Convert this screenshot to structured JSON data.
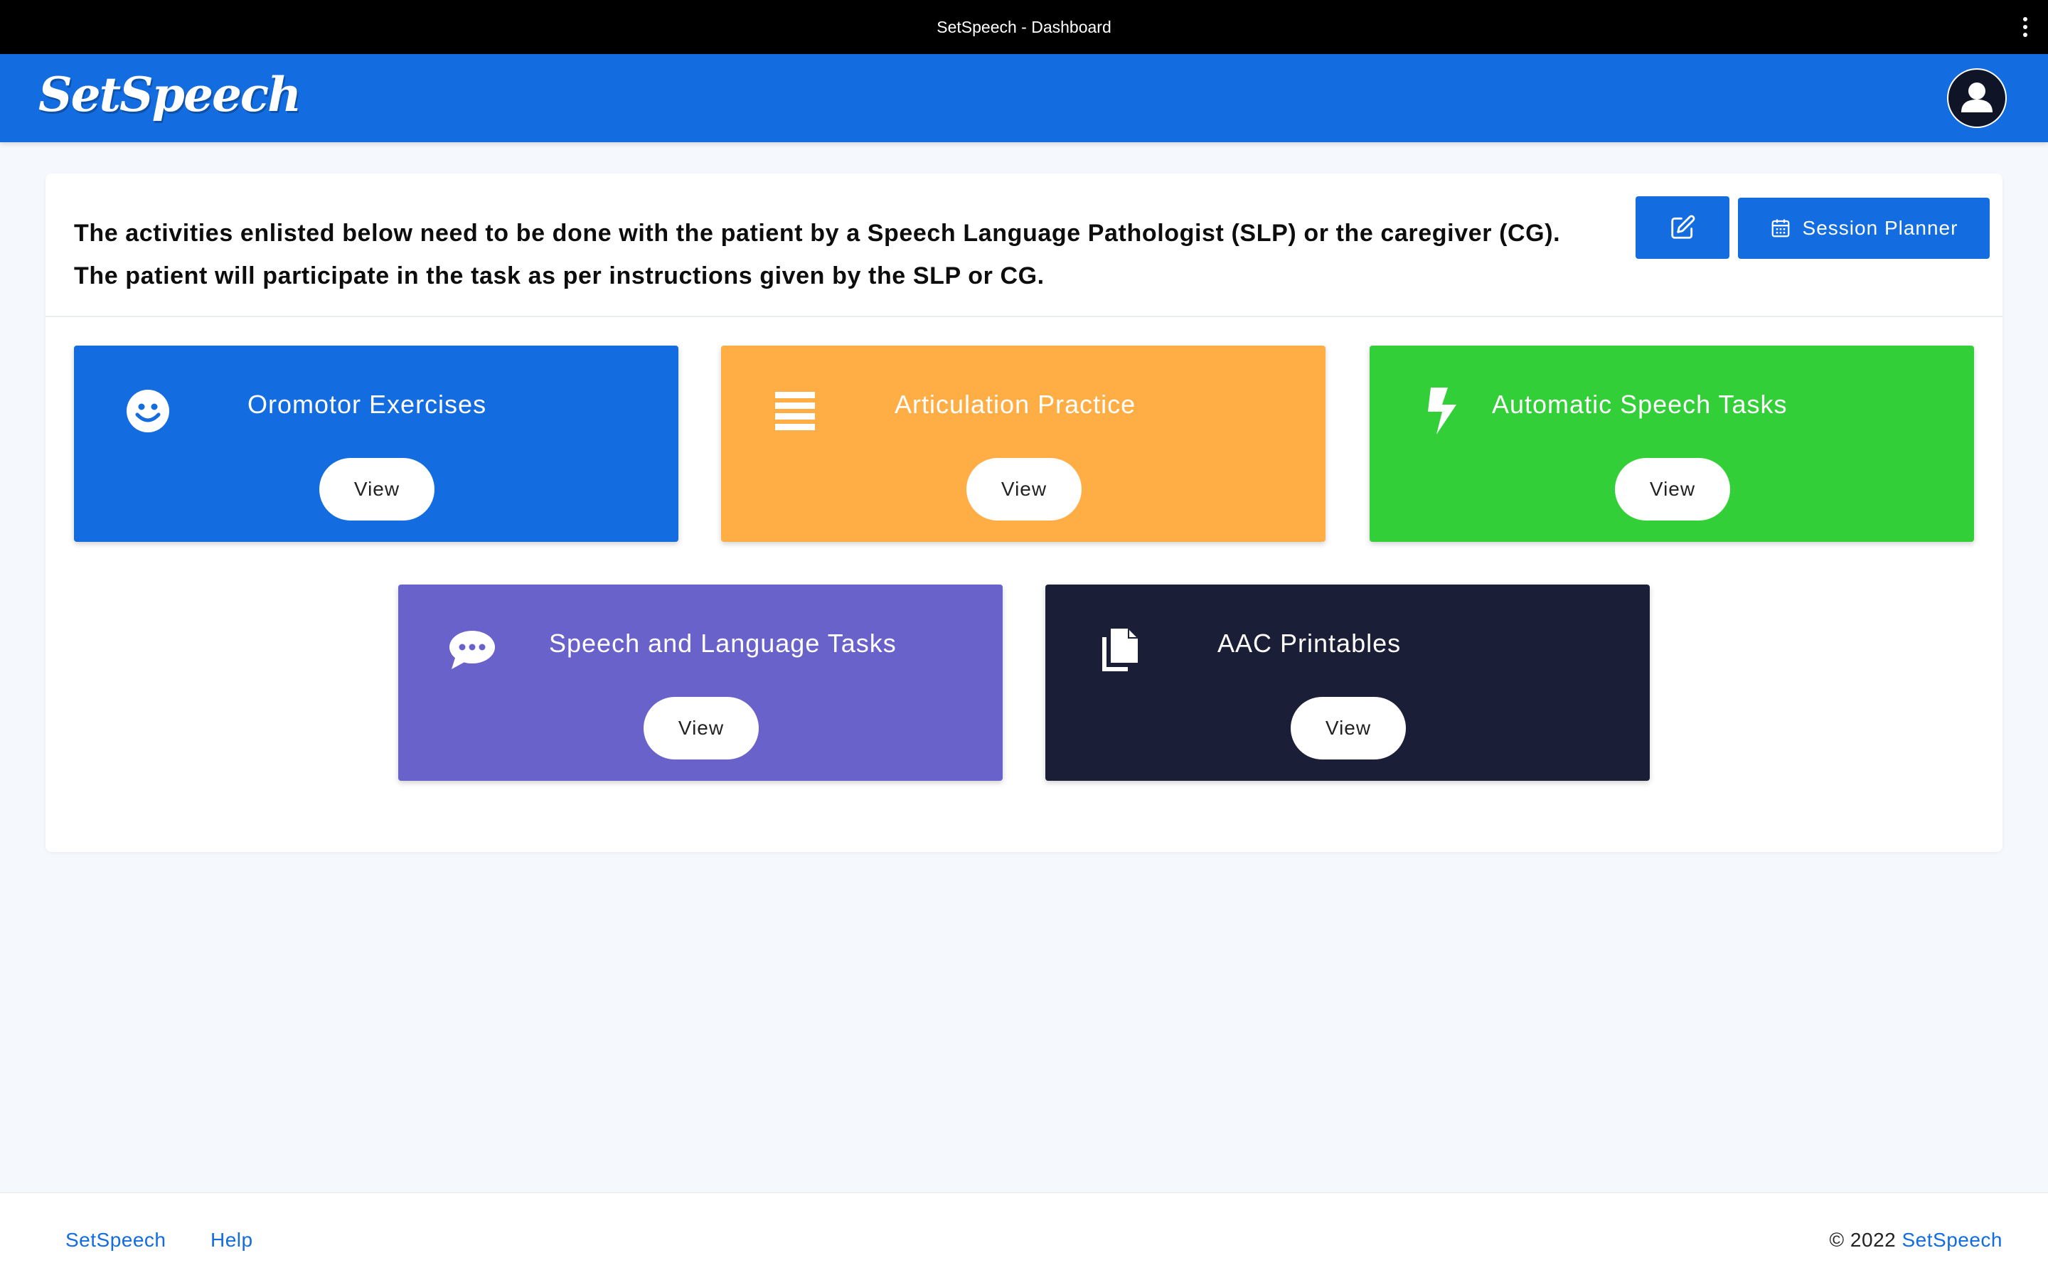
{
  "window": {
    "title": "SetSpeech - Dashboard"
  },
  "header": {
    "logo_text": "SetSpeech",
    "avatar_icon": "user-avatar-icon"
  },
  "intro": {
    "line1": "The activities enlisted below need to be done with the patient by a Speech Language Pathologist (SLP) or the caregiver (CG).",
    "line2": "The patient will participate in the task as per instructions given by the SLP or CG."
  },
  "toolbar": {
    "edit_icon": "edit-icon",
    "planner_icon": "calendar-icon",
    "planner_label": "Session Planner"
  },
  "activities": [
    {
      "title": "Oromotor Exercises",
      "button": "View",
      "icon": "smile-icon",
      "color": "#136ce0"
    },
    {
      "title": "Articulation Practice",
      "button": "View",
      "icon": "list-lines-icon",
      "color": "#ffae45"
    },
    {
      "title": "Automatic Speech Tasks",
      "button": "View",
      "icon": "lightning-icon",
      "color": "#33cf38"
    },
    {
      "title": "Speech and Language Tasks",
      "button": "View",
      "icon": "chat-bubble-icon",
      "color": "#6a62cb"
    },
    {
      "title": "AAC Printables",
      "button": "View",
      "icon": "documents-icon",
      "color": "#1a1f37"
    }
  ],
  "footer": {
    "link1": "SetSpeech",
    "link2": "Help",
    "copyright_prefix": "© 2022 ",
    "copyright_brand": "SetSpeech"
  },
  "colors": {
    "primary": "#136ce0",
    "background": "#f5f8fd"
  }
}
